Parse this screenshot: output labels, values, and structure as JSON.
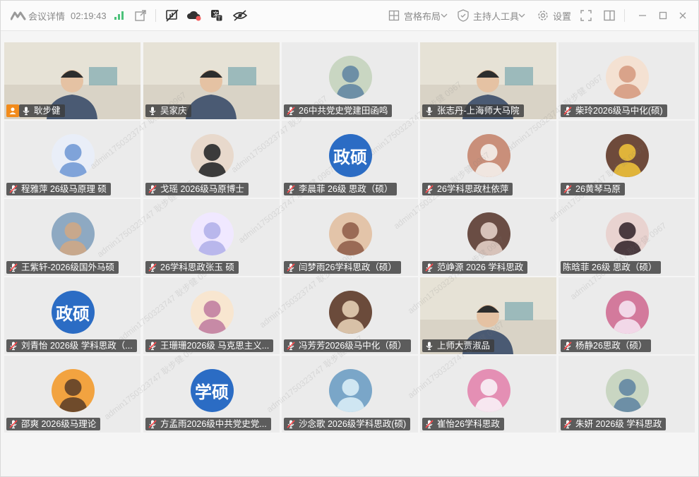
{
  "titlebar": {
    "meeting_details": "会议详情",
    "timer": "02:19:43",
    "layout_label": "宫格布局",
    "host_tools_label": "主持人工具",
    "settings_label": "设置"
  },
  "watermark": "admin1750323747 耿步健 0967",
  "participants": [
    {
      "name": "耿步健",
      "mic": "on",
      "video": true,
      "host": true
    },
    {
      "name": "吴家庆",
      "mic": "on",
      "video": true,
      "active": true
    },
    {
      "name": "26中共党史党建田函鸣",
      "mic": "muted",
      "avatar": "photo"
    },
    {
      "name": "张志丹-上海师大马院",
      "mic": "on",
      "video": true
    },
    {
      "name": "柴玲2026级马中化(硕)",
      "mic": "muted",
      "avatar": "photo"
    },
    {
      "name": "程雅萍 26级马原理 硕",
      "mic": "muted",
      "avatar": "photo"
    },
    {
      "name": "戈瑶 2026级马原博士",
      "mic": "muted",
      "avatar": "photo"
    },
    {
      "name": "李晨菲 26级 思政（硕）",
      "mic": "muted",
      "avatar_text": "政硕"
    },
    {
      "name": "26学科思政杜依萍",
      "mic": "muted",
      "avatar": "photo"
    },
    {
      "name": "26黄琴马原",
      "mic": "muted",
      "avatar": "photo"
    },
    {
      "name": "王紫轩-2026级国外马硕",
      "mic": "muted",
      "avatar": "photo"
    },
    {
      "name": "26学科思政张玉 硕",
      "mic": "muted",
      "avatar": "photo"
    },
    {
      "name": "闫梦雨26学科思政（硕）",
      "mic": "muted",
      "avatar": "photo"
    },
    {
      "name": "范峥源 2026 学科思政",
      "mic": "muted",
      "avatar": "photo"
    },
    {
      "name": "陈晗菲 26级 思政（硕）",
      "mic": "none",
      "avatar": "photo"
    },
    {
      "name": "刘青怡 2026级 学科思政（...",
      "mic": "muted",
      "avatar_text": "政硕"
    },
    {
      "name": "王珊珊2026级 马克思主义...",
      "mic": "muted",
      "avatar": "photo"
    },
    {
      "name": "冯芳芳2026级马中化（硕）",
      "mic": "muted",
      "avatar": "photo"
    },
    {
      "name": "上师大贾淑品",
      "mic": "on",
      "video": true
    },
    {
      "name": "杨静26思政（硕）",
      "mic": "muted",
      "avatar": "photo"
    },
    {
      "name": "邵爽 2026级马理论",
      "mic": "muted",
      "avatar": "photo"
    },
    {
      "name": "方孟雨2026级中共党史党...",
      "mic": "muted",
      "avatar_text": "学硕"
    },
    {
      "name": "沙念歌 2026级学科思政(硕)",
      "mic": "muted",
      "avatar": "photo"
    },
    {
      "name": "崔怡26学科思政",
      "mic": "muted",
      "avatar": "photo"
    },
    {
      "name": "朱妍 2026级 学科思政",
      "mic": "muted",
      "avatar": "photo"
    }
  ]
}
